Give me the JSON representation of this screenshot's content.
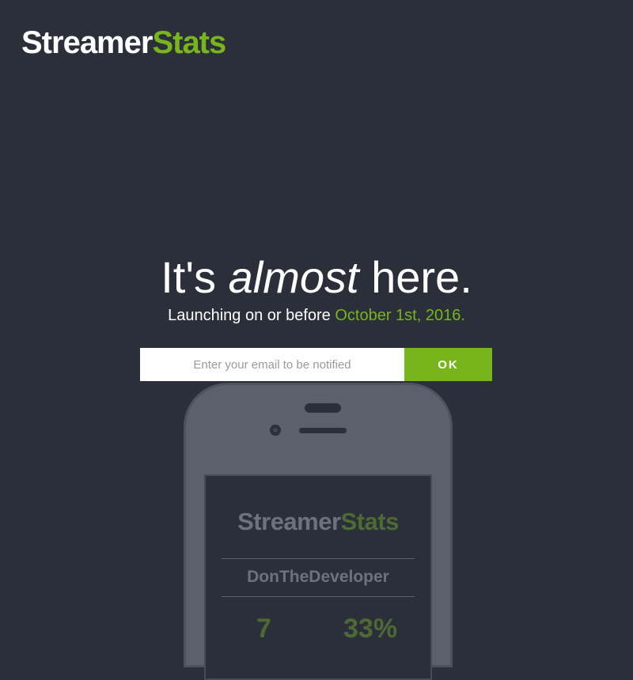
{
  "header": {
    "logo_part1": "Streamer",
    "logo_part2": "Stats"
  },
  "hero": {
    "headline_start": "It's ",
    "headline_emphasis": "almost",
    "headline_end": " here.",
    "subline_prefix": "Launching on or before ",
    "subline_date": "October 1st, 2016."
  },
  "signup": {
    "email_placeholder": "Enter your email to be notified",
    "email_value": "",
    "submit_label": "OK"
  },
  "phone_mockup": {
    "logo_part1": "Streamer",
    "logo_part2": "Stats",
    "username": "DonTheDeveloper",
    "stat_1": "7",
    "stat_2": "33%"
  },
  "colors": {
    "background": "#2a2f3a",
    "accent": "#78b51d",
    "phone_body": "#5b616c"
  }
}
